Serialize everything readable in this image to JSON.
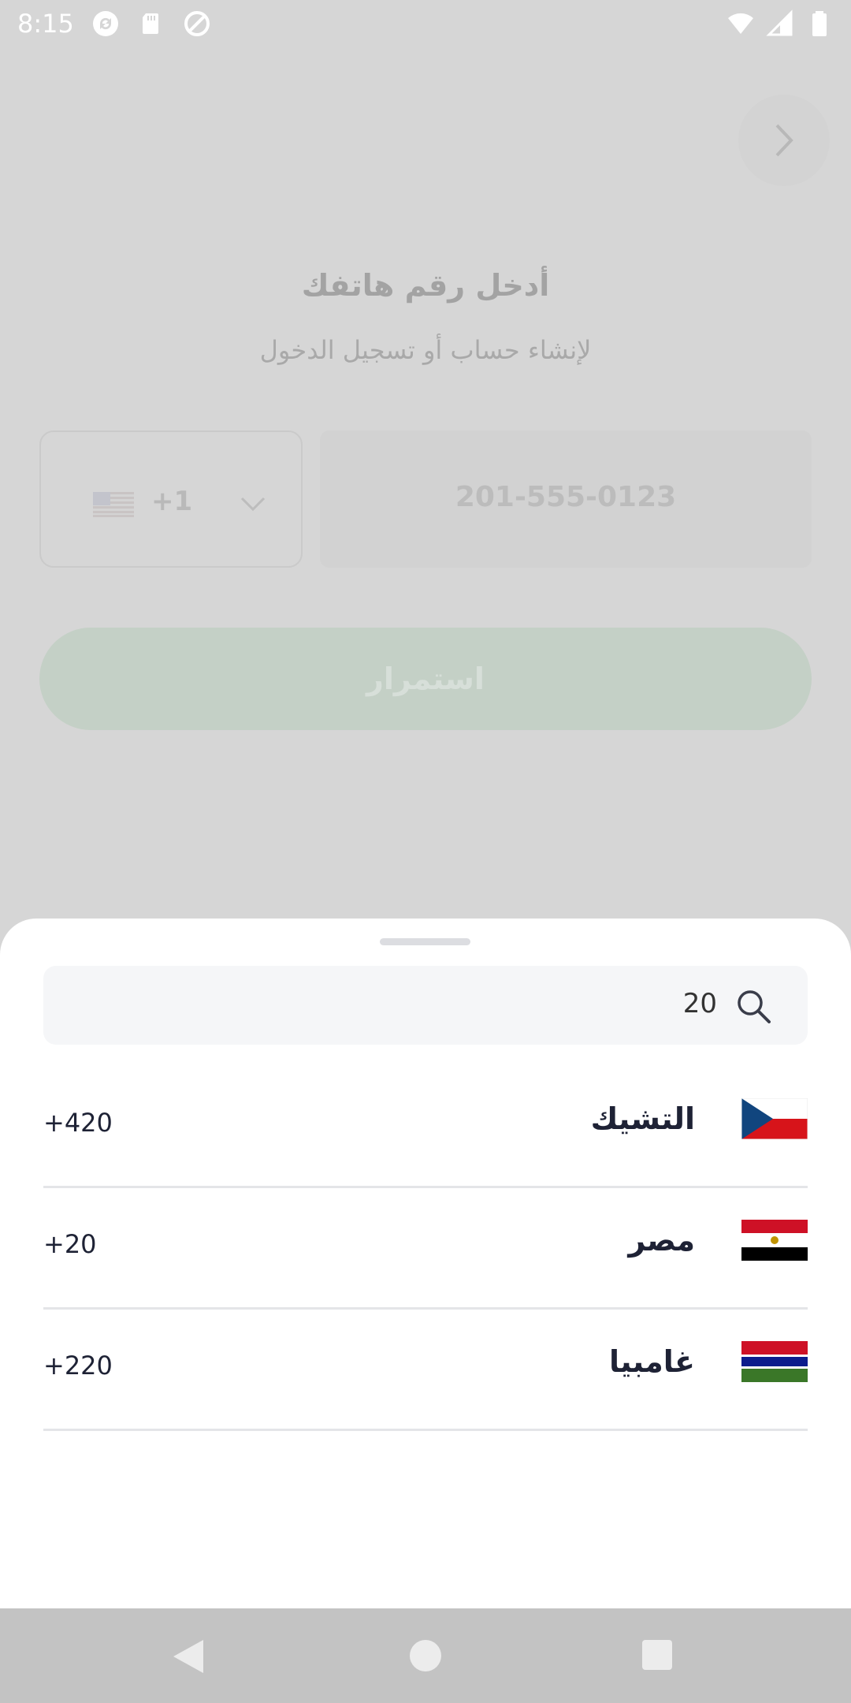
{
  "status_bar": {
    "time": "8:15",
    "icons": [
      "sync-icon",
      "sd-card-icon",
      "blocked-icon",
      "wifi-icon",
      "signal-icon",
      "battery-icon"
    ]
  },
  "background_screen": {
    "title": "أدخل رقم هاتفك",
    "subtitle": "لإنشاء حساب أو تسجيل الدخول",
    "country_code": "+1",
    "phone_placeholder": "201-555-0123",
    "continue_label": "استمرار"
  },
  "country_sheet": {
    "search_value": "20",
    "countries": [
      {
        "name": "التشيك",
        "code": "+420"
      },
      {
        "name": "مصر",
        "code": "+20"
      },
      {
        "name": "غامبيا",
        "code": "+220"
      }
    ]
  },
  "colors": {
    "text_dark": "#1e2235",
    "divider": "#e4e5e8",
    "button_disabled": "#c4d0c6"
  }
}
